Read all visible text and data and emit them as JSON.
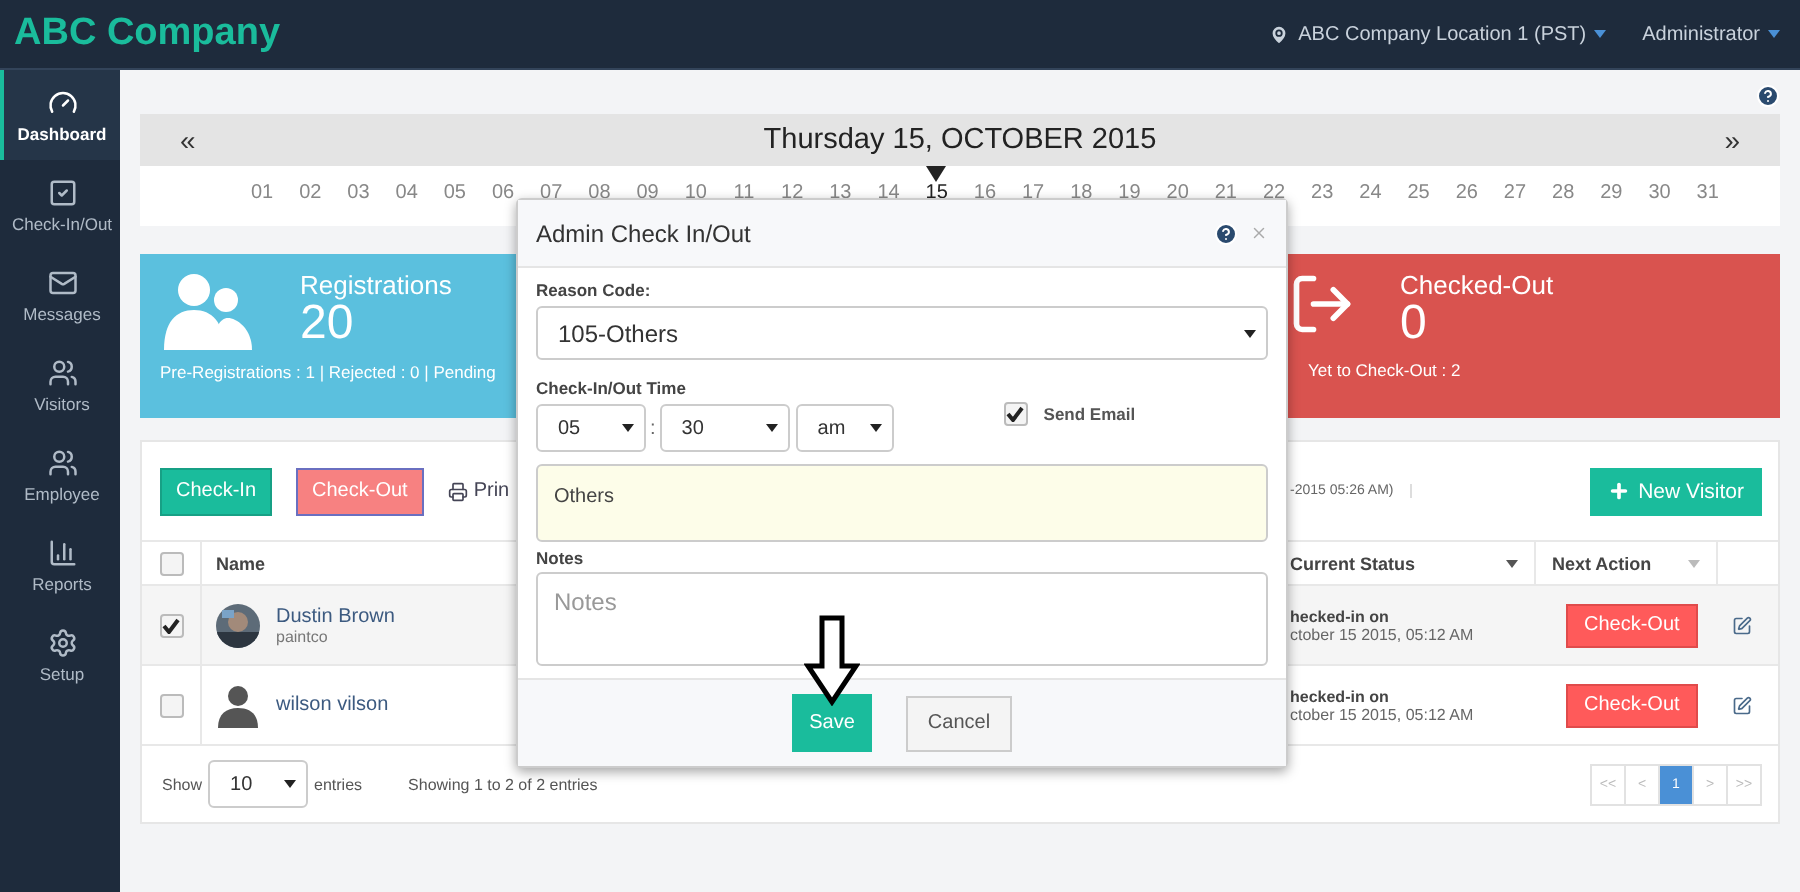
{
  "header": {
    "brand": "ABC Company",
    "location": "ABC Company Location 1 (PST)",
    "user": "Administrator"
  },
  "sidebar": {
    "items": [
      {
        "label": "Dashboard",
        "kind": "gauge",
        "selected": true
      },
      {
        "label": "Check-In/Out",
        "kind": "check",
        "selected": false
      },
      {
        "label": "Messages",
        "kind": "mail",
        "selected": false
      },
      {
        "label": "Visitors",
        "kind": "users",
        "selected": false
      },
      {
        "label": "Employee",
        "kind": "users",
        "selected": false
      },
      {
        "label": "Reports",
        "kind": "chart",
        "selected": false
      },
      {
        "label": "Setup",
        "kind": "gear",
        "selected": false
      }
    ]
  },
  "calendar": {
    "title": "Thursday 15, OCTOBER 2015",
    "prev": "«",
    "next": "»",
    "days": [
      {
        "label": "01",
        "selected": false
      },
      {
        "label": "02",
        "selected": false
      },
      {
        "label": "03",
        "selected": false
      },
      {
        "label": "04",
        "selected": false
      },
      {
        "label": "05",
        "selected": false
      },
      {
        "label": "06",
        "selected": false
      },
      {
        "label": "07",
        "selected": false
      },
      {
        "label": "08",
        "selected": false
      },
      {
        "label": "09",
        "selected": false
      },
      {
        "label": "10",
        "selected": false
      },
      {
        "label": "11",
        "selected": false
      },
      {
        "label": "12",
        "selected": false
      },
      {
        "label": "13",
        "selected": false
      },
      {
        "label": "14",
        "selected": false
      },
      {
        "label": "15",
        "selected": true
      },
      {
        "label": "16",
        "selected": false
      },
      {
        "label": "17",
        "selected": false
      },
      {
        "label": "18",
        "selected": false
      },
      {
        "label": "19",
        "selected": false
      },
      {
        "label": "20",
        "selected": false
      },
      {
        "label": "21",
        "selected": false
      },
      {
        "label": "22",
        "selected": false
      },
      {
        "label": "23",
        "selected": false
      },
      {
        "label": "24",
        "selected": false
      },
      {
        "label": "25",
        "selected": false
      },
      {
        "label": "26",
        "selected": false
      },
      {
        "label": "27",
        "selected": false
      },
      {
        "label": "28",
        "selected": false
      },
      {
        "label": "29",
        "selected": false
      },
      {
        "label": "30",
        "selected": false
      },
      {
        "label": "31",
        "selected": false
      }
    ]
  },
  "stats": [
    {
      "kind": "people",
      "title": "Registrations",
      "value": "20",
      "detail": "Pre-Registrations : 1 | Rejected : 0 | Pending",
      "color": "#5bc0de"
    },
    {
      "kind": "exit",
      "title": "Checked-Out",
      "value": "0",
      "detail": "Yet to Check-Out : 2",
      "color": "#d9534f"
    }
  ],
  "toolbar": {
    "buttons": [
      {
        "label": "Check-In",
        "kind": "success"
      },
      {
        "label": "Check-Out",
        "kind": "danger"
      }
    ],
    "print": "Prin",
    "timestamp": "-2015 05:26 AM)",
    "new_visitor": "New Visitor"
  },
  "table": {
    "select_all": {
      "checked": false
    },
    "columns": [
      "Name",
      "Current Status",
      "Next Action"
    ],
    "rows": [
      {
        "checked": true,
        "kind": "picture",
        "name": "Dustin Brown",
        "company": "paintco",
        "status": "hecked-in on",
        "time": "ctober 15 2015, 05:12 AM",
        "action": "Check-Out"
      },
      {
        "checked": false,
        "kind": "silhouette",
        "name": "wilson vilson",
        "status": "hecked-in on",
        "time": "ctober 15 2015, 05:12 AM",
        "action": "Check-Out"
      }
    ]
  },
  "footer": {
    "show": "Show",
    "page_size": "10",
    "entries": "entries",
    "info": "Showing 1 to 2 of 2 entries",
    "pages": [
      {
        "label": "<<",
        "selected": false,
        "disabled": true
      },
      {
        "label": "<",
        "selected": false,
        "disabled": true
      },
      {
        "label": "1",
        "selected": true,
        "disabled": false
      },
      {
        "label": ">",
        "selected": false,
        "disabled": true
      },
      {
        "label": ">>",
        "selected": false,
        "disabled": true
      }
    ]
  },
  "modal": {
    "title": "Admin Check In/Out",
    "reason_label": "Reason Code:",
    "reason": "105-Others",
    "time_label": "Check-In/Out Time",
    "hour": "05",
    "separator": ":",
    "minute": "30",
    "ampm": "am",
    "send_email": {
      "label": "Send Email",
      "checked": true
    },
    "comment": "Others",
    "notes_label": "Notes",
    "notes_placeholder": "Notes",
    "save": "Save",
    "cancel": "Cancel"
  }
}
